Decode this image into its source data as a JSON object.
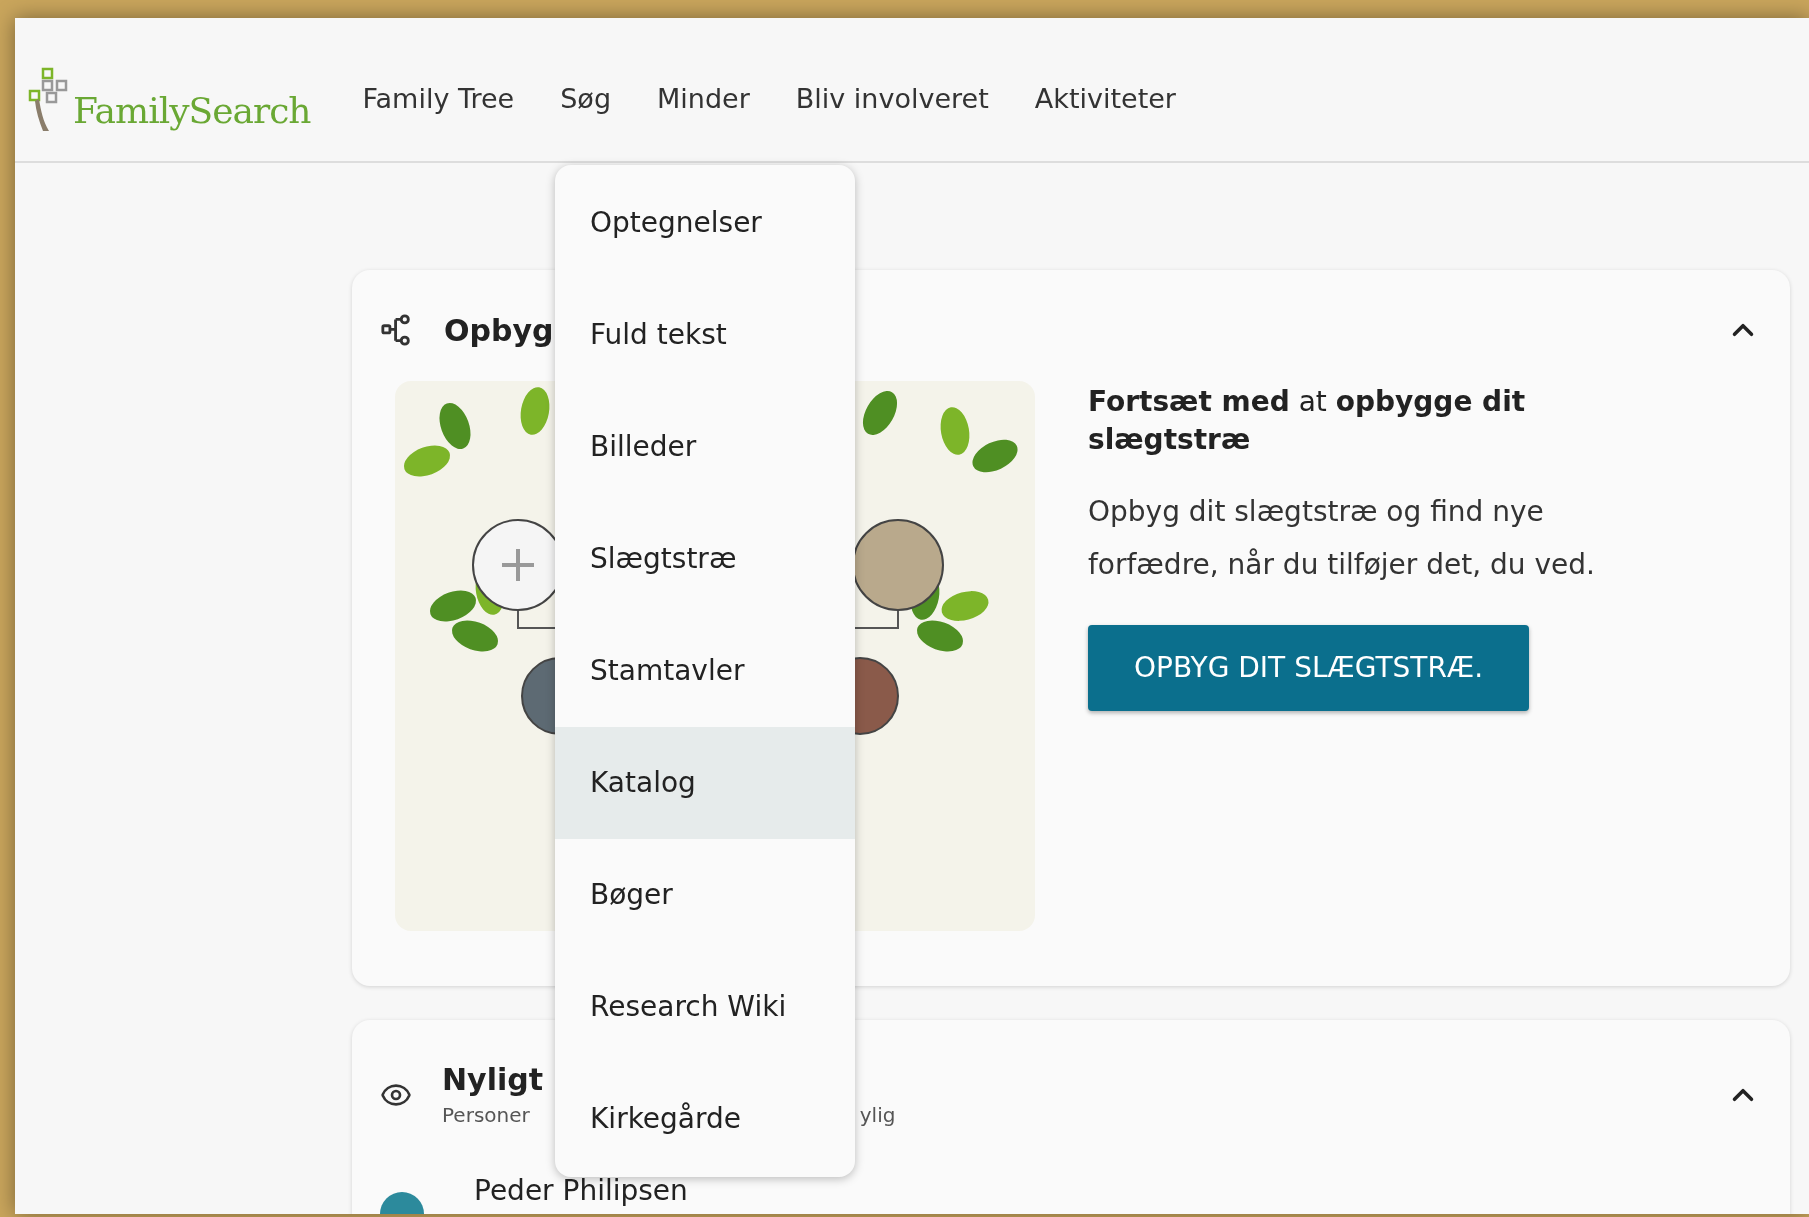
{
  "header": {
    "logo": "FamilySearch",
    "nav": [
      {
        "label": "Family Tree"
      },
      {
        "label": "Søg"
      },
      {
        "label": "Minder"
      },
      {
        "label": "Bliv involveret"
      },
      {
        "label": "Aktiviteter"
      }
    ]
  },
  "search_menu": {
    "items": [
      {
        "label": "Optegnelser",
        "selected": false
      },
      {
        "label": "Fuld tekst",
        "selected": false
      },
      {
        "label": "Billeder",
        "selected": false
      },
      {
        "label": "Slægtstræ",
        "selected": false
      },
      {
        "label": "Stamtavler",
        "selected": false
      },
      {
        "label": "Katalog",
        "selected": true
      },
      {
        "label": "Bøger",
        "selected": false
      },
      {
        "label": "Research Wiki",
        "selected": false
      },
      {
        "label": "Kirkegårde",
        "selected": false
      }
    ]
  },
  "build_card": {
    "title": "Opbyg",
    "expanded": true,
    "heading": "**Fortsæt med** at **opbygge dit slægtstræ**",
    "description": "Opbyg dit slægtstræ og find nye forfædre, når du tilføjer det, du ved.",
    "button": "OPBYG DIT SLÆGTSTRÆ."
  },
  "recent_card": {
    "title": "Nyligt",
    "subtitle_start": "Personer",
    "subtitle_end": "ylig",
    "expanded": true,
    "people": [
      {
        "name": "Peder Philipsen"
      }
    ]
  }
}
